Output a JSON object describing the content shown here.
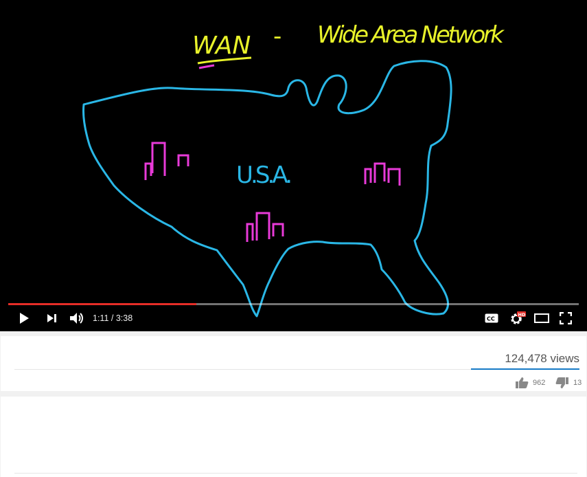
{
  "video": {
    "drawing": {
      "title_acronym": "WAN",
      "title_dash": "-",
      "title_full": "Wide Area Network",
      "map_label": "U.S.A.",
      "colors": {
        "outline": "#2ab7e6",
        "title": "#e8f22a",
        "city": "#e83ad8",
        "label": "#2ab7e6"
      }
    },
    "progress_fraction": 0.33,
    "time_current": "1:11",
    "time_separator": " / ",
    "time_total": "3:38",
    "hd_badge": "HD",
    "icons": [
      "play-icon",
      "next-icon",
      "volume-icon",
      "captions-icon",
      "settings-icon",
      "theater-mode-icon",
      "fullscreen-icon"
    ]
  },
  "stats": {
    "views": "124,478 views",
    "likes": "962",
    "dislikes": "13",
    "icons": [
      "thumbs-up-icon",
      "thumbs-down-icon"
    ],
    "accent_color": "#167ac6"
  }
}
